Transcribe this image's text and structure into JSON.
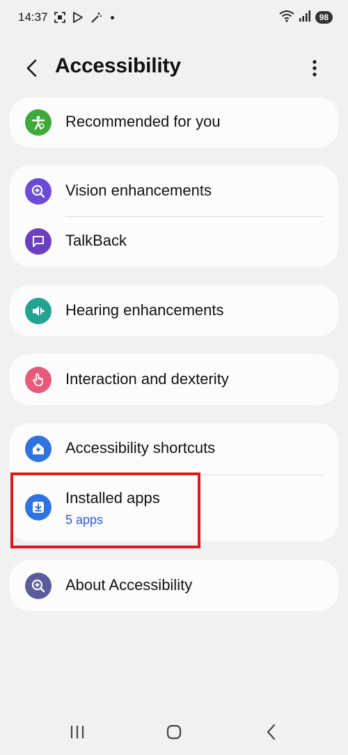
{
  "status": {
    "time": "14:37",
    "battery": "98",
    "icons": [
      "screenshot-icon",
      "play-store-icon",
      "magic-wand-icon",
      "wifi-icon",
      "signal-icon"
    ]
  },
  "header": {
    "title": "Accessibility"
  },
  "items": {
    "recommended": {
      "label": "Recommended for you",
      "icon": "accessibility-person-icon",
      "color": "#3daa3a"
    },
    "vision": {
      "label": "Vision enhancements",
      "icon": "zoom-plus-icon",
      "color": "#6a4cd6"
    },
    "talkback": {
      "label": "TalkBack",
      "icon": "message-icon",
      "color": "#6b3fbf"
    },
    "hearing": {
      "label": "Hearing enhancements",
      "icon": "hearing-icon",
      "color": "#23a38f"
    },
    "interaction": {
      "label": "Interaction and dexterity",
      "icon": "touch-hand-icon",
      "color": "#e85a7a"
    },
    "shortcuts": {
      "label": "Accessibility shortcuts",
      "icon": "home-plus-icon",
      "color": "#2f73e0"
    },
    "installed": {
      "label": "Installed apps",
      "sub": "5 apps",
      "icon": "download-box-icon",
      "color": "#2f73e0"
    },
    "about": {
      "label": "About Accessibility",
      "icon": "info-zoom-icon",
      "color": "#5b5a9b"
    }
  },
  "colors": {
    "background": "#f1f1f3",
    "card": "#fcfcfd",
    "highlight": "#e01818",
    "link": "#2a5bd7"
  },
  "nav": {
    "icons": [
      "recents-icon",
      "home-icon",
      "back-icon"
    ]
  }
}
